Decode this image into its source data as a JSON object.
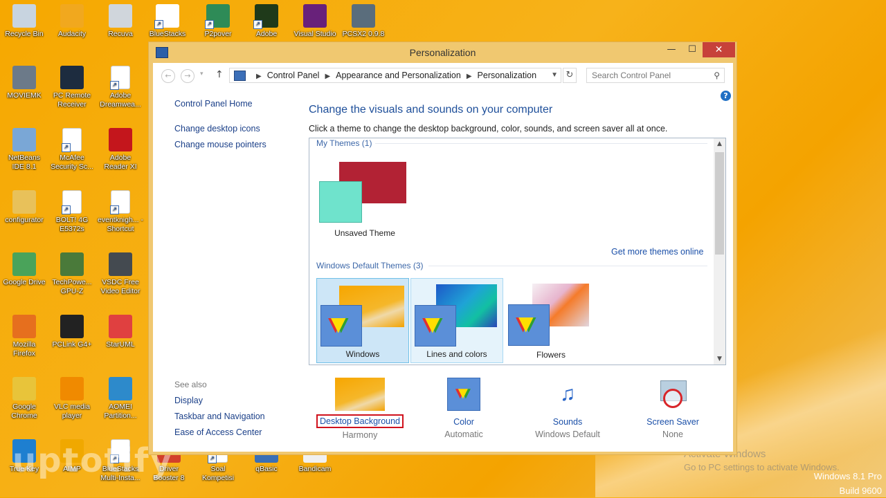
{
  "desktop": {
    "icons": [
      {
        "label": "Recycle Bin",
        "icon": "recycle-bin-icon"
      },
      {
        "label": "Audacity",
        "icon": "audacity-icon"
      },
      {
        "label": "Recuva",
        "icon": "recuva-icon"
      },
      {
        "label": "BlueStacks",
        "icon": "bluestacks-icon"
      },
      {
        "label": "P2pover",
        "icon": "p2pover-icon"
      },
      {
        "label": "Adobe",
        "icon": "dreamweaver-icon"
      },
      {
        "label": "Visual Studio",
        "icon": "visual-studio-icon"
      },
      {
        "label": "PCSX2 0.9.8",
        "icon": "pcsx2-icon"
      },
      {
        "label": "MOVIEMK",
        "icon": "moviemaker-icon"
      },
      {
        "label": "PC Remote Receiver",
        "icon": "pc-remote-icon"
      },
      {
        "label": "Adobe Dreamwea...",
        "icon": "file-icon"
      },
      {
        "label": "NetBeans IDE 8.1",
        "icon": "netbeans-icon"
      },
      {
        "label": "McAfee Security Sc...",
        "icon": "file-icon"
      },
      {
        "label": "Adobe Reader XI",
        "icon": "adobe-reader-icon"
      },
      {
        "label": "configurator",
        "icon": "folder-icon"
      },
      {
        "label": "BOLT! 4G E5372s",
        "icon": "file-icon"
      },
      {
        "label": "eventknigh... - Shortcut",
        "icon": "file-icon"
      },
      {
        "label": "Google Drive",
        "icon": "google-drive-icon"
      },
      {
        "label": "TechPowe... GPU-Z",
        "icon": "gpu-z-icon"
      },
      {
        "label": "VSDC Free Video Editor",
        "icon": "vsdc-icon"
      },
      {
        "label": "Mozilla Firefox",
        "icon": "firefox-icon"
      },
      {
        "label": "PCLink G4+",
        "icon": "pclink-icon"
      },
      {
        "label": "StarUML",
        "icon": "staruml-icon"
      },
      {
        "label": "Google Chrome",
        "icon": "chrome-icon"
      },
      {
        "label": "VLC media player",
        "icon": "vlc-icon"
      },
      {
        "label": "AOMEI Partition...",
        "icon": "aomei-icon"
      },
      {
        "label": "True Key",
        "icon": "true-key-icon"
      },
      {
        "label": "AIMP",
        "icon": "aimp-icon"
      },
      {
        "label": "BlueStacks Multi-Insta...",
        "icon": "file-icon"
      },
      {
        "label": "Driver Booster 8",
        "icon": "driver-booster-icon"
      },
      {
        "label": "Soal Kompetisi",
        "icon": "file-icon"
      },
      {
        "label": "qBasic",
        "icon": "qbasic-icon"
      },
      {
        "label": "Bandicam",
        "icon": "bandicam-icon"
      }
    ],
    "watermark": "uptotify",
    "activate_line1": "Activate Windows",
    "activate_line2": "Go to PC settings to activate Windows.",
    "os_name": "Windows 8.1 Pro",
    "os_build": "Build 9600"
  },
  "window": {
    "title": "Personalization",
    "minimize": "—",
    "maximize": "☐",
    "close": "✕",
    "breadcrumbs": [
      "Control Panel",
      "Appearance and Personalization",
      "Personalization"
    ],
    "search_placeholder": "Search Control Panel",
    "help": "?",
    "left_links": {
      "home": "Control Panel Home",
      "desktop_icons": "Change desktop icons",
      "mouse_pointers": "Change mouse pointers",
      "see_also": "See also",
      "display": "Display",
      "taskbar": "Taskbar and Navigation",
      "ease": "Ease of Access Center"
    },
    "heading": "Change the visuals and sounds on your computer",
    "subheading": "Click a theme to change the desktop background, color, sounds, and screen saver all at once.",
    "my_themes_label": "My Themes (1)",
    "unsaved_theme": "Unsaved Theme",
    "get_more": "Get more themes online",
    "default_themes_label": "Windows Default Themes (3)",
    "default_themes": [
      "Windows",
      "Lines and colors",
      "Flowers"
    ],
    "bottom": [
      {
        "label": "Desktop Background",
        "value": "Harmony"
      },
      {
        "label": "Color",
        "value": "Automatic"
      },
      {
        "label": "Sounds",
        "value": "Windows Default"
      },
      {
        "label": "Screen Saver",
        "value": "None"
      }
    ]
  },
  "colors": {
    "accent_link": "#1a4fa8",
    "close_button": "#c7413a",
    "highlight_box": "#d0111c",
    "wallpaper": "#f6a800"
  }
}
